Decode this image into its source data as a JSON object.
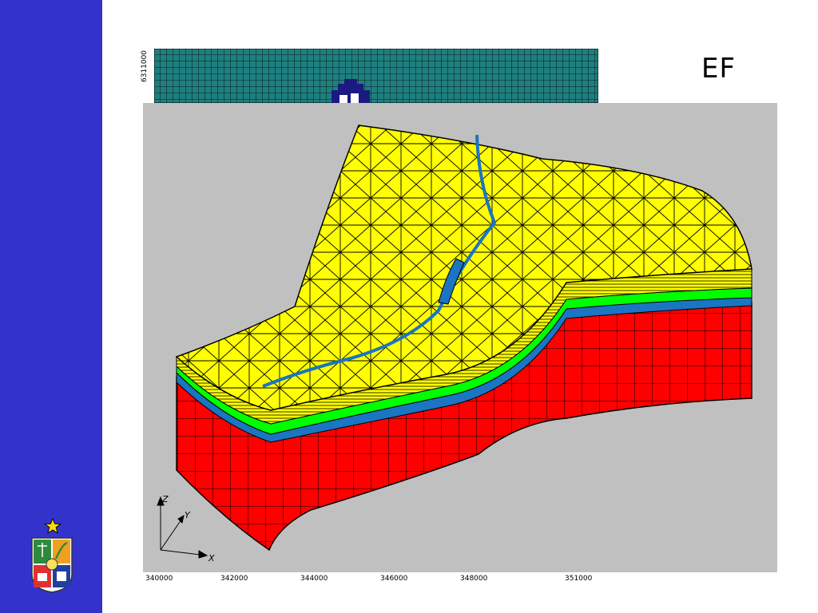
{
  "slide": {
    "title": "EF",
    "y_tick_label": "6311000",
    "x_tick_labels": [
      "340000",
      "342000",
      "344000",
      "346000",
      "348000",
      "351000"
    ],
    "axis_labels": {
      "z": "Z",
      "y": "Y",
      "x": "X"
    }
  },
  "colors": {
    "sidebar": "#3333cc",
    "grid_fill": "#1f7f7f",
    "mesh_surface": "#ffff00",
    "bottom_layer": "#ff0000",
    "green_layer": "#00ff00",
    "blue_layer": "#1a75c2",
    "panel_background": "#c0c0c0"
  }
}
